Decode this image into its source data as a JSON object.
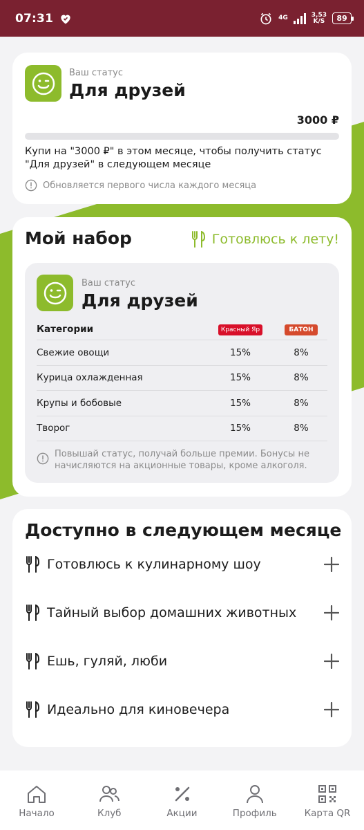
{
  "statusbar": {
    "time": "07:31",
    "network": "4G",
    "speed_value": "3,53",
    "speed_unit": "K/S",
    "battery": "89"
  },
  "colors": {
    "accent": "#8dbb2c",
    "statusbar": "#7a2130",
    "brand_krasny": "#d8102a",
    "brand_baton": "#d54a2d"
  },
  "status_card": {
    "label": "Ваш статус",
    "title": "Для друзей",
    "amount": "3000 ₽",
    "progress_fraction": 0,
    "description": "Купи на \"3000 ₽\" в этом месяце, чтобы получить статус \"Для друзей\" в следующем месяце",
    "note": "Обновляется первого числа каждого месяца",
    "avatar_icon": "smile-wink-icon",
    "note_icon": "info-icon"
  },
  "set_card": {
    "title": "Мой набор",
    "theme_label": "Готовлюсь к лету!",
    "theme_icon": "fork-knife-icon",
    "inner": {
      "label": "Ваш статус",
      "title": "Для друзей",
      "table": {
        "headers": {
          "category": "Категории",
          "brand1": "Красный Яр",
          "brand2": "БАТОН"
        },
        "rows": [
          {
            "category": "Свежие овощи",
            "v1": "15%",
            "v2": "8%"
          },
          {
            "category": "Курица охлажденная",
            "v1": "15%",
            "v2": "8%"
          },
          {
            "category": "Крупы и бобовые",
            "v1": "15%",
            "v2": "8%"
          },
          {
            "category": "Творог",
            "v1": "15%",
            "v2": "8%"
          }
        ]
      },
      "note": "Повышай статус, получай больше премии. Бонусы не начисляются на акционные товары, кроме алкоголя."
    }
  },
  "next_month": {
    "title": "Доступно в следующем месяце",
    "items": [
      {
        "label": "Готовлюсь к кулинарному шоу"
      },
      {
        "label": "Тайный выбор домашних животных"
      },
      {
        "label": "Ешь, гуляй, люби"
      },
      {
        "label": "Идеально для киновечера"
      }
    ]
  },
  "bottom_nav": [
    {
      "label": "Начало",
      "icon": "home-icon"
    },
    {
      "label": "Клуб",
      "icon": "users-icon"
    },
    {
      "label": "Акции",
      "icon": "percent-icon"
    },
    {
      "label": "Профиль",
      "icon": "profile-icon"
    },
    {
      "label": "Карта QR",
      "icon": "qr-code-icon"
    }
  ]
}
